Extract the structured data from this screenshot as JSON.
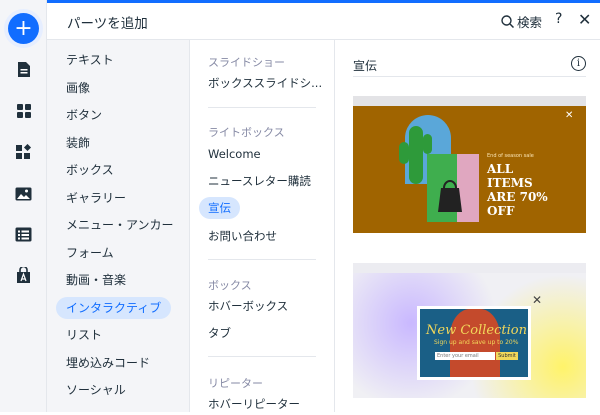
{
  "header": {
    "title": "パーツを追加",
    "search_label": "検索",
    "help_label": "?",
    "close_label": "✕"
  },
  "rail": {
    "add_label": "+",
    "items": [
      "page-icon",
      "apps-grid-icon",
      "puzzle-icon",
      "image-icon",
      "table-icon",
      "market-icon"
    ]
  },
  "categories": [
    {
      "label": "テキスト"
    },
    {
      "label": "画像"
    },
    {
      "label": "ボタン"
    },
    {
      "label": "装飾"
    },
    {
      "label": "ボックス"
    },
    {
      "label": "ギャラリー"
    },
    {
      "label": "メニュー・アンカー"
    },
    {
      "label": "フォーム"
    },
    {
      "label": "動画・音楽"
    },
    {
      "label": "インタラクティブ",
      "active": true
    },
    {
      "label": "リスト"
    },
    {
      "label": "埋め込みコード"
    },
    {
      "label": "ソーシャル"
    }
  ],
  "subsections": {
    "slideshow": {
      "title": "スライドショー",
      "items": [
        "ボックススライドシ..."
      ]
    },
    "lightbox": {
      "title": "ライトボックス",
      "items": [
        "Welcome",
        "ニュースレター購読",
        "宣伝",
        "お問い合わせ"
      ],
      "active": "宣伝"
    },
    "box": {
      "title": "ボックス",
      "items": [
        "ホバーボックス",
        "タブ"
      ]
    },
    "repeater": {
      "title": "リピーター",
      "items": [
        "ホバーリピーター"
      ]
    }
  },
  "preview": {
    "title": "宣伝",
    "info_label": "i",
    "card1": {
      "small_text": "End of season sale",
      "headline": "ALL ITEMS ARE 70% OFF",
      "close_label": "✕",
      "colors": {
        "background": "#a06400",
        "cactus": "#2e9a3a",
        "arch": "#5aa7d9"
      }
    },
    "card2": {
      "headline": "New Collection",
      "subline": "Sign up and save up to 20%",
      "field_placeholder": "Enter your email",
      "submit_label": "Submit",
      "close_label": "✕"
    }
  },
  "colors": {
    "accent": "#116dff",
    "active_bg": "#d6e6fe"
  }
}
